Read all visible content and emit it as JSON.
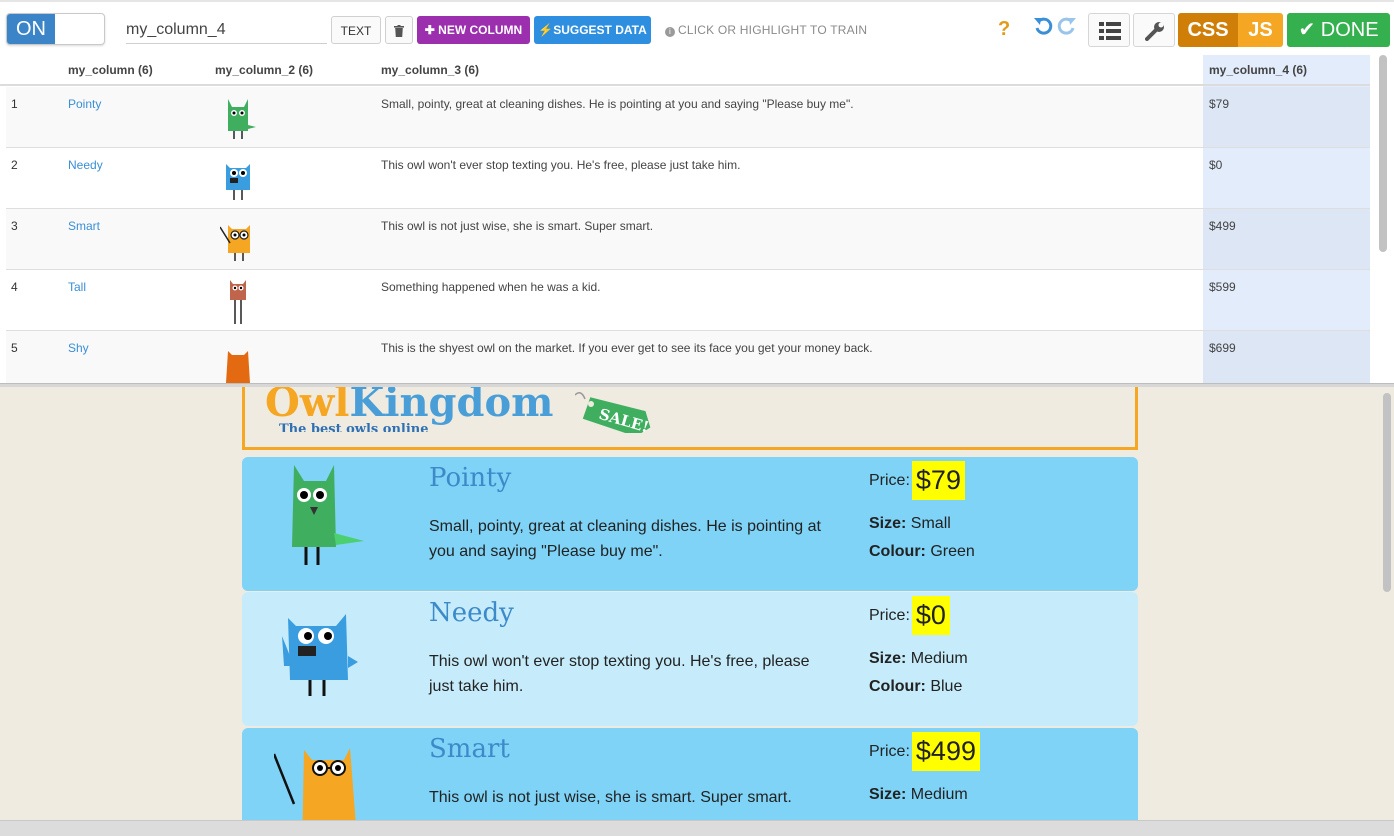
{
  "toolbar": {
    "toggle_label": "ON",
    "column_name_value": "my_column_4",
    "text_button": "TEXT",
    "new_column_button": "✚ NEW COLUMN",
    "suggest_data_button": "⚡SUGGEST DATA",
    "train_hint": "CLICK OR HIGHLIGHT TO TRAIN",
    "help_label": "?",
    "css_label": "CSS",
    "js_label": "JS",
    "done_label": "✔ DONE"
  },
  "grid": {
    "headers": [
      "my_column (6)",
      "my_column_2 (6)",
      "my_column_3 (6)",
      "my_column_4 (6)"
    ],
    "rows": [
      {
        "num": "1",
        "name": "Pointy",
        "desc": "Small, pointy, great at cleaning dishes. He is pointing at you and saying \"Please buy me\".",
        "price": "$79",
        "color": "#3fae5f"
      },
      {
        "num": "2",
        "name": "Needy",
        "desc": "This owl won't ever stop texting you. He's free, please just take him.",
        "price": "$0",
        "color": "#3a9de0"
      },
      {
        "num": "3",
        "name": "Smart",
        "desc": "This owl is not just wise, she is smart. Super smart.",
        "price": "$499",
        "color": "#f5a623"
      },
      {
        "num": "4",
        "name": "Tall",
        "desc": "Something happened when he was a kid.",
        "price": "$599",
        "color": "#c0654b"
      },
      {
        "num": "5",
        "name": "Shy",
        "desc": "This is the shyest owl on the market. If you ever get to see its face you get your money back.",
        "price": "$699",
        "color": "#e36a10"
      }
    ]
  },
  "preview": {
    "logo_owl": "Owl",
    "logo_kingdom": "Kingdom",
    "tagline": "The best owls online",
    "sale_tag": "SALE!",
    "price_label": "Price:",
    "size_label": "Size:",
    "colour_label": "Colour:",
    "cards": [
      {
        "name": "Pointy",
        "text": "Small, pointy, great at cleaning dishes. He is pointing at you and saying \"Please buy me\".",
        "price": "$79",
        "size": "Small",
        "colour": "Green"
      },
      {
        "name": "Needy",
        "text": "This owl won't ever stop texting you. He's free, please just take him.",
        "price": "$0",
        "size": "Medium",
        "colour": "Blue"
      },
      {
        "name": "Smart",
        "text": "This owl is not just wise, she is smart. Super smart.",
        "price": "$499",
        "size": "Medium",
        "colour": ""
      }
    ]
  },
  "colors": {
    "accent_blue": "#3a84c7",
    "new_column": "#9b2fae",
    "suggest": "#2e8fe0",
    "css": "#cf7e08",
    "js": "#f5a623",
    "done": "#35b04e",
    "highlight_column": "#e2ecfa",
    "price_highlight": "#ffff00"
  }
}
